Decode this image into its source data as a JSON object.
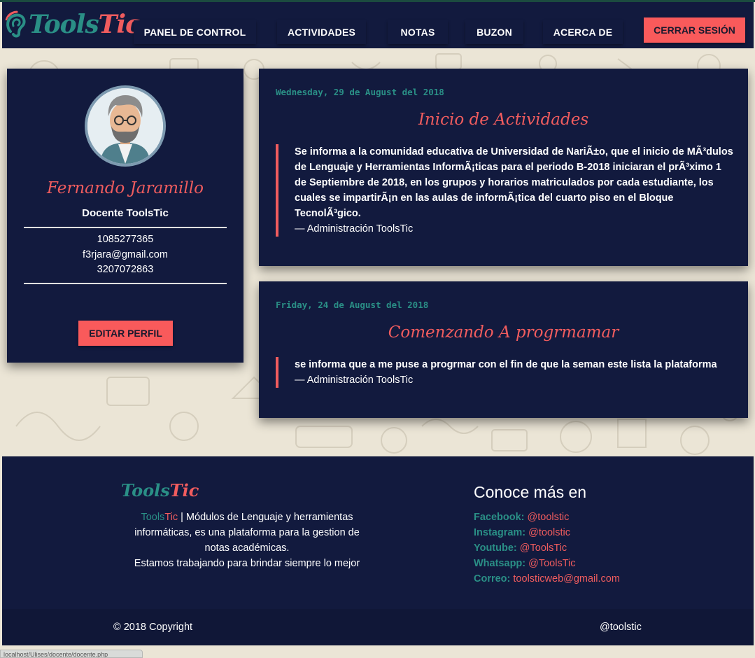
{
  "brand": {
    "name_part1": "Tools",
    "name_part2": "Tic",
    "colors": {
      "navy": "#121a3e",
      "coral": "#f95a5b",
      "teal": "#2a8f86"
    }
  },
  "nav": {
    "items": [
      {
        "label": "PANEL DE CONTROL"
      },
      {
        "label": "ACTIVIDADES"
      },
      {
        "label": "NOTAS"
      },
      {
        "label": "BUZON"
      },
      {
        "label": "ACERCA DE"
      }
    ],
    "logout_label": "CERRAR SESIÓN"
  },
  "profile": {
    "name": "Fernando Jaramillo",
    "role": "Docente ToolsTic",
    "id_number": "1085277365",
    "email": "f3rjara@gmail.com",
    "phone": "3207072863",
    "edit_label": "EDITAR PERFIL",
    "avatar_icon": "teacher-avatar-icon"
  },
  "news": [
    {
      "date": "Wednesday, 29 de August del 2018",
      "title": "Inicio de Actividades",
      "body": "Se informa a la comunidad educativa de Universidad de NariÃ±o, que el inicio de MÃ³dulos de Lenguaje y Herramientas InformÃ¡ticas para el periodo B-2018 iniciaran el prÃ³ximo 1 de Septiembre de 2018, en los grupos y horarios matriculados por cada estudiante, los cuales se impartirÃ¡n en las aulas de informÃ¡tica del cuarto piso en el Bloque TecnolÃ³gico.",
      "footer": "— Administración ToolsTic"
    },
    {
      "date": "Friday, 24 de August del 2018",
      "title": "Comenzando A progrmamar",
      "body": "se informa que a me puse a progrmar con el fin de que la seman este lista la plataforma",
      "footer": "— Administración ToolsTic"
    }
  ],
  "footer": {
    "logo_part1": "Tools",
    "logo_part2": "Tic",
    "desc_brand1": "Tools",
    "desc_brand2": "Tic",
    "desc_text": " | Módulos de Lenguaje y herramientas informáticas, es una plataforma para la gestion de notas académicas.",
    "desc_text2": "Estamos trabajando para brindar siempre lo mejor",
    "heading": "Conoce más en",
    "links": [
      {
        "label": "Facebook:",
        "value": "@toolstic"
      },
      {
        "label": "Instagram:",
        "value": "@toolstic"
      },
      {
        "label": "Youtube:",
        "value": "@ToolsTic"
      },
      {
        "label": "Whatsapp:",
        "value": "@ToolsTic"
      },
      {
        "label": "Correo:",
        "value": "toolsticweb@gmail.com"
      }
    ],
    "copyright": "© 2018 Copyright",
    "handle": "@toolstic"
  },
  "statusbar": {
    "text": "localhost/Ulises/docente/docente.php"
  }
}
